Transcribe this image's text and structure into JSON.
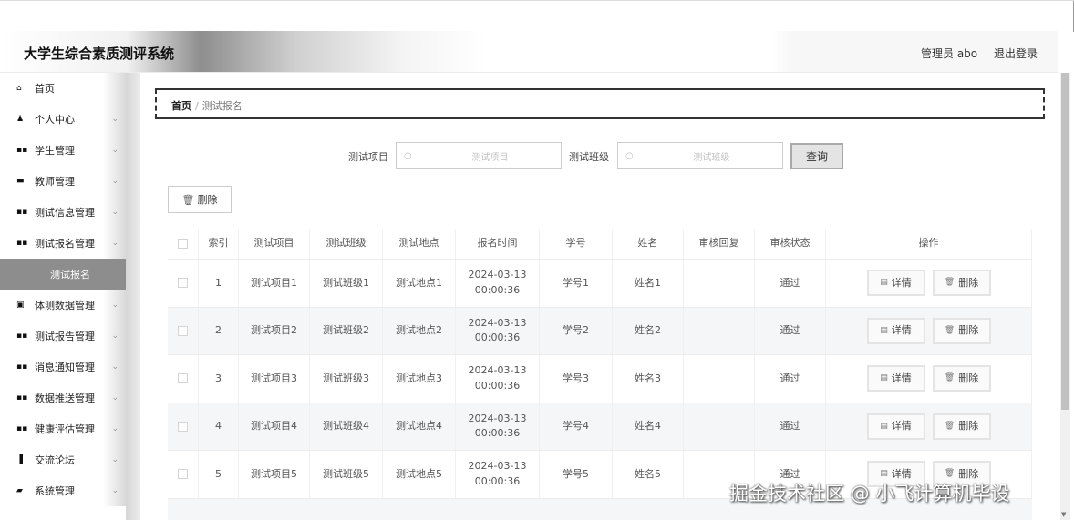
{
  "header": {
    "app_title": "大学生综合素质测评系统",
    "admin_label": "管理员 abo",
    "logout_label": "退出登录"
  },
  "sidebar": {
    "items": [
      {
        "label": "首页",
        "icon": "home-icon",
        "chevron": false
      },
      {
        "label": "个人中心",
        "icon": "user-icon",
        "chevron": true
      },
      {
        "label": "学生管理",
        "icon": "grid-icon",
        "chevron": true
      },
      {
        "label": "教师管理",
        "icon": "teacher-icon",
        "chevron": true
      },
      {
        "label": "测试信息管理",
        "icon": "grid-icon",
        "chevron": true
      },
      {
        "label": "测试报名管理",
        "icon": "grid-icon",
        "chevron": true
      },
      {
        "label": "测试报名",
        "sub": true
      },
      {
        "label": "体测数据管理",
        "icon": "clipboard-icon",
        "chevron": true
      },
      {
        "label": "测试报告管理",
        "icon": "grid-icon",
        "chevron": true
      },
      {
        "label": "消息通知管理",
        "icon": "grid-icon",
        "chevron": true
      },
      {
        "label": "数据推送管理",
        "icon": "grid-icon",
        "chevron": true
      },
      {
        "label": "健康评估管理",
        "icon": "grid-icon",
        "chevron": true
      },
      {
        "label": "交流论坛",
        "icon": "forum-icon",
        "chevron": true
      },
      {
        "label": "系统管理",
        "icon": "settings-icon",
        "chevron": true
      }
    ]
  },
  "breadcrumb": {
    "home": "首页",
    "separator": "/",
    "current": "测试报名"
  },
  "search": {
    "project_label": "测试项目",
    "project_placeholder": "测试项目",
    "class_label": "测试班级",
    "class_placeholder": "测试班级",
    "query_label": "查询"
  },
  "toolbar": {
    "delete_label": "删除"
  },
  "table": {
    "headers": [
      "索引",
      "测试项目",
      "测试班级",
      "测试地点",
      "报名时间",
      "学号",
      "姓名",
      "审核回复",
      "审核状态",
      "操作"
    ],
    "rows": [
      {
        "index": "1",
        "project": "测试项目1",
        "class": "测试班级1",
        "place": "测试地点1",
        "date": "2024-03-13",
        "time": "00:00:36",
        "sid": "学号1",
        "name": "姓名1",
        "reply": "",
        "status": "通过"
      },
      {
        "index": "2",
        "project": "测试项目2",
        "class": "测试班级2",
        "place": "测试地点2",
        "date": "2024-03-13",
        "time": "00:00:36",
        "sid": "学号2",
        "name": "姓名2",
        "reply": "",
        "status": "通过"
      },
      {
        "index": "3",
        "project": "测试项目3",
        "class": "测试班级3",
        "place": "测试地点3",
        "date": "2024-03-13",
        "time": "00:00:36",
        "sid": "学号3",
        "name": "姓名3",
        "reply": "",
        "status": "通过"
      },
      {
        "index": "4",
        "project": "测试项目4",
        "class": "测试班级4",
        "place": "测试地点4",
        "date": "2024-03-13",
        "time": "00:00:36",
        "sid": "学号4",
        "name": "姓名4",
        "reply": "",
        "status": "通过"
      },
      {
        "index": "5",
        "project": "测试项目5",
        "class": "测试班级5",
        "place": "测试地点5",
        "date": "2024-03-13",
        "time": "00:00:36",
        "sid": "学号5",
        "name": "姓名5",
        "reply": "",
        "status": "通过"
      }
    ],
    "partial_row_date": "2024-03-13",
    "detail_label": "详情",
    "delete_label": "删除"
  },
  "watermark": "掘金技术社区 @ 小飞计算机毕设",
  "colors": {
    "sidebar_active": "#8d8d8d",
    "row_alt": "#f4f6f8"
  }
}
